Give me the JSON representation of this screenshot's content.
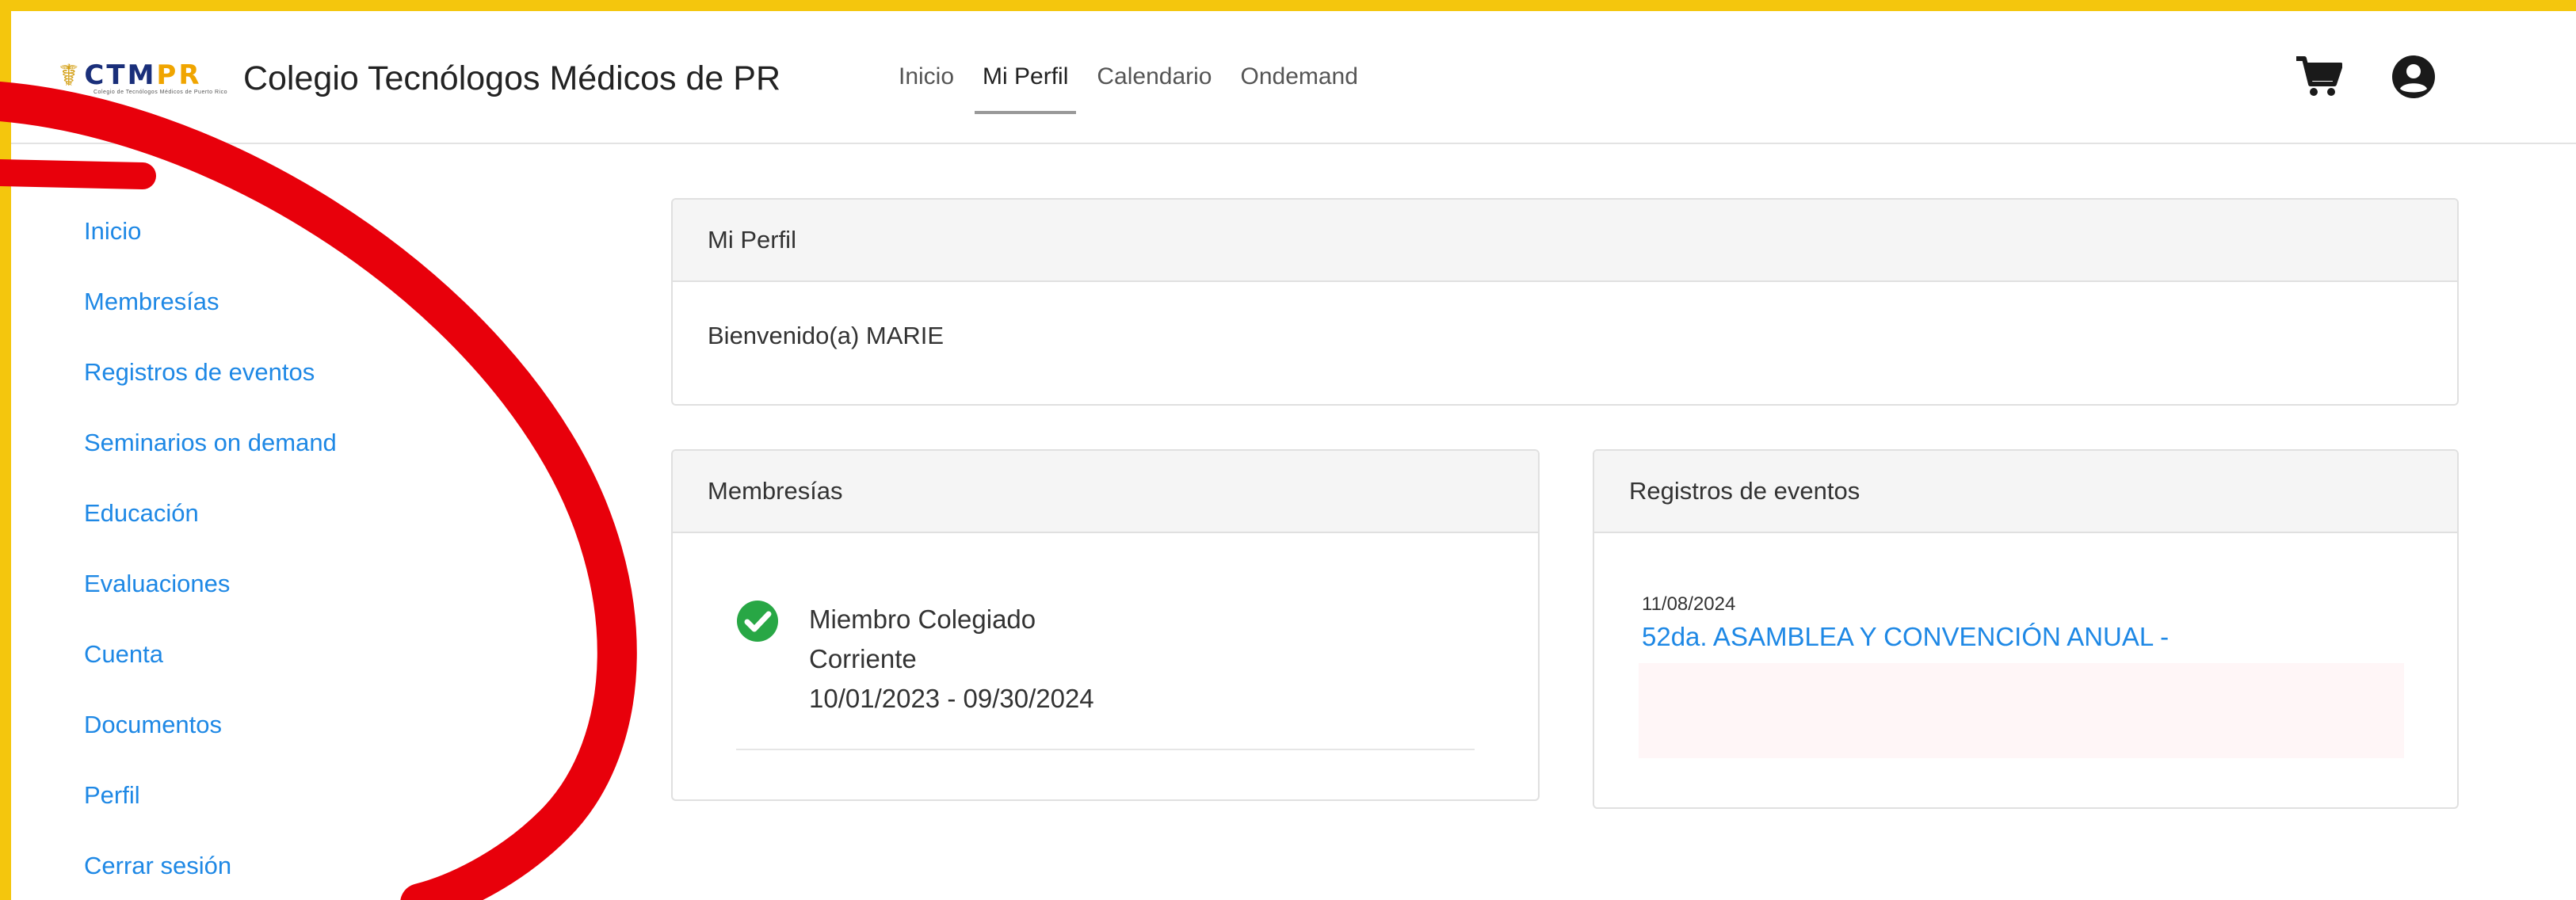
{
  "header": {
    "logo": {
      "main_left": "CTM",
      "main_right": "PR",
      "tagline": "Colegio de Tecnólogos Médicos de Puerto Rico"
    },
    "brand_name": "Colegio Tecnólogos Médicos de PR",
    "nav": [
      {
        "label": "Inicio"
      },
      {
        "label": "Mi Perfil",
        "active": true
      },
      {
        "label": "Calendario"
      },
      {
        "label": "Ondemand"
      }
    ],
    "icons": [
      "cart-icon",
      "user-circle-icon"
    ]
  },
  "sidebar": {
    "items": [
      {
        "label": "Inicio"
      },
      {
        "label": "Membresías"
      },
      {
        "label": "Registros de eventos"
      },
      {
        "label": "Seminarios on demand"
      },
      {
        "label": "Educación"
      },
      {
        "label": "Evaluaciones"
      },
      {
        "label": "Cuenta"
      },
      {
        "label": "Documentos"
      },
      {
        "label": "Perfil"
      },
      {
        "label": "Cerrar sesión"
      }
    ]
  },
  "profile_card": {
    "title": "Mi Perfil",
    "welcome": "Bienvenido(a) MARIE"
  },
  "membership_card": {
    "title": "Membresías",
    "type": "Miembro Colegiado",
    "status": "Corriente",
    "period": "10/01/2023 - 09/30/2024"
  },
  "events_card": {
    "title": "Registros de eventos",
    "date": "11/08/2024",
    "event_title": "52da. ASAMBLEA Y CONVENCIÓN ANUAL -"
  },
  "colors": {
    "frame": "#f4c60d",
    "link": "#1e88e5",
    "annotation": "#e8000b",
    "check": "#28a745"
  }
}
